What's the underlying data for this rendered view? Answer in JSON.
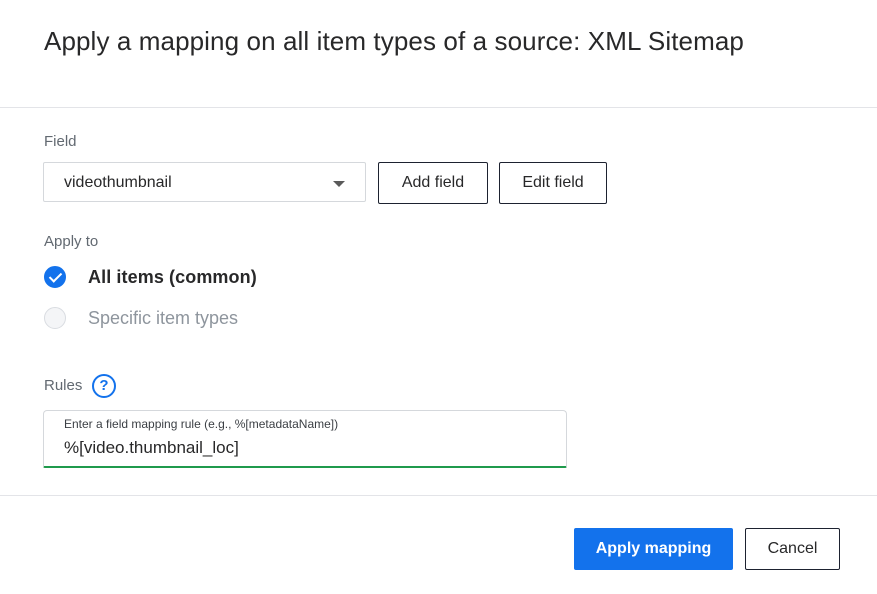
{
  "dialog": {
    "title": "Apply a mapping on all item types of a source: XML Sitemap"
  },
  "field": {
    "label": "Field",
    "selected_value": "videothumbnail",
    "add_button": "Add field",
    "edit_button": "Edit field"
  },
  "apply_to": {
    "label": "Apply to",
    "options": [
      {
        "label": "All items (common)",
        "checked": true
      },
      {
        "label": "Specific item types",
        "checked": false
      }
    ]
  },
  "rules": {
    "label": "Rules",
    "help_glyph": "?",
    "input_label": "Enter a field mapping rule (e.g., %[metadataName])",
    "input_value": "%[video.thumbnail_loc]"
  },
  "footer": {
    "apply_button": "Apply mapping",
    "cancel_button": "Cancel"
  },
  "colors": {
    "primary": "#1372ec",
    "valid_underline": "#1f9a4c"
  },
  "icons": {
    "dropdown": "chevron-down-icon",
    "help": "help-icon",
    "check": "checkmark-icon"
  }
}
